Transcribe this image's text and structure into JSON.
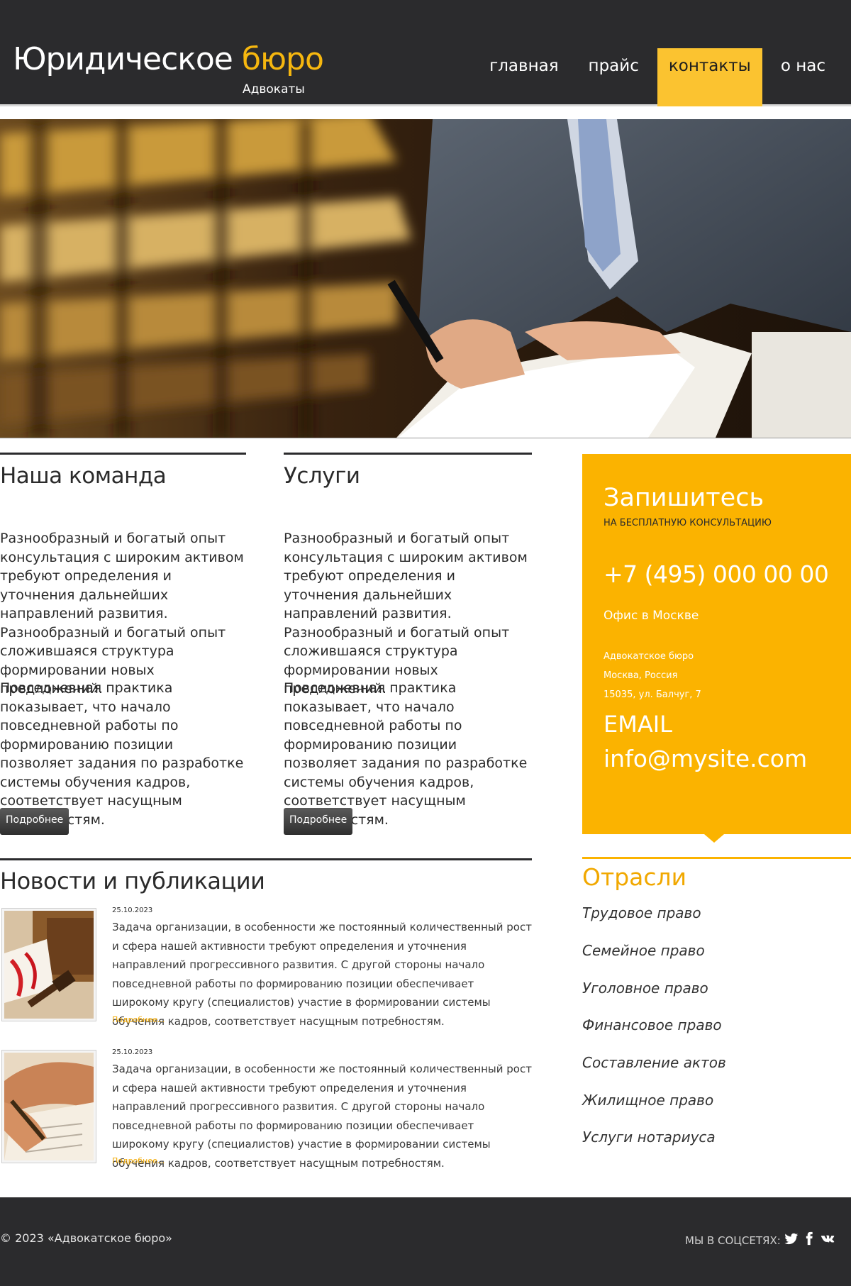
{
  "header": {
    "logo_main": "Юридическое",
    "logo_accent": "бюро",
    "logo_sub": "Адвокаты",
    "nav": [
      {
        "label": "главная",
        "active": false
      },
      {
        "label": "прайс",
        "active": false
      },
      {
        "label": "контакты",
        "active": true
      },
      {
        "label": "о нас",
        "active": false
      }
    ]
  },
  "columns": [
    {
      "title": "Наша команда",
      "p1": "Разнообразный и богатый опыт консультация с широким активом требуют определения и уточнения дальнейших направлений развития. Разнообразный и богатый опыт сложившаяся структура формировании новых предложений.",
      "p2": "Повседневная практика показывает, что начало повседневной работы по формированию позиции позволяет задания по разработке системы обучения кадров, соответствует насущным потребностям.",
      "button": "Подробнее"
    },
    {
      "title": "Услуги",
      "p1": "Разнообразный и богатый опыт консультация с широким активом требуют определения и уточнения дальнейших направлений развития. Разнообразный и богатый опыт сложившаяся структура формировании новых предложений.",
      "p2": "Повседневная практика показывает, что начало повседневной работы по формированию позиции позволяет задания по разработке системы обучения кадров, соответствует насущным потребностям.",
      "button": "Подробнее"
    }
  ],
  "contact": {
    "title": "Запишитесь",
    "subtitle": "НА БЕСПЛАТНУЮ КОНСУЛЬТАЦИЮ",
    "phone": "+7 (495) 000 00 00",
    "office": "Офис в Москве",
    "address_line1": "Адвокатское бюро",
    "address_line2": "Москва, Россия",
    "address_line3": "15035, ул. Балчуг, 7",
    "email_label": "EMAIL",
    "email": "info@mysite.com"
  },
  "news": {
    "title": "Новости и публикации",
    "items": [
      {
        "date": "25.10.2023",
        "text": "Задача организации, в особенности же постоянный количественный рост и сфера нашей активности требуют определения и уточнения направлений прогрессивного развития. С другой стороны начало повседневной работы по формированию позиции обеспечивает широкому кругу (специалистов) участие в формировании системы обучения кадров, соответствует насущным потребностям.",
        "more": "Подробнее..."
      },
      {
        "date": "25.10.2023",
        "text": "Задача организации, в особенности же постоянный количественный рост и сфера нашей активности требуют определения и уточнения направлений прогрессивного развития. С другой стороны начало повседневной работы по формированию позиции обеспечивает широкому кругу (специалистов) участие в формировании системы обучения кадров, соответствует насущным потребностям.",
        "more": "Подробнее..."
      }
    ]
  },
  "sectors": {
    "title": "Отрасли",
    "items": [
      "Трудовое право",
      "Семейное право",
      "Уголовное право",
      "Финансовое право",
      "Составление актов",
      "Жилищное право",
      "Услуги нотариуса"
    ]
  },
  "footer": {
    "copyright": "© 2023 «Адвокатское бюро»",
    "social_label": "МЫ В СОЦСЕТЯХ:",
    "social_icons": [
      "twitter-icon",
      "facebook-icon",
      "vk-icon"
    ]
  },
  "colors": {
    "accent": "#fbb300",
    "dark": "#2b2b2d"
  }
}
